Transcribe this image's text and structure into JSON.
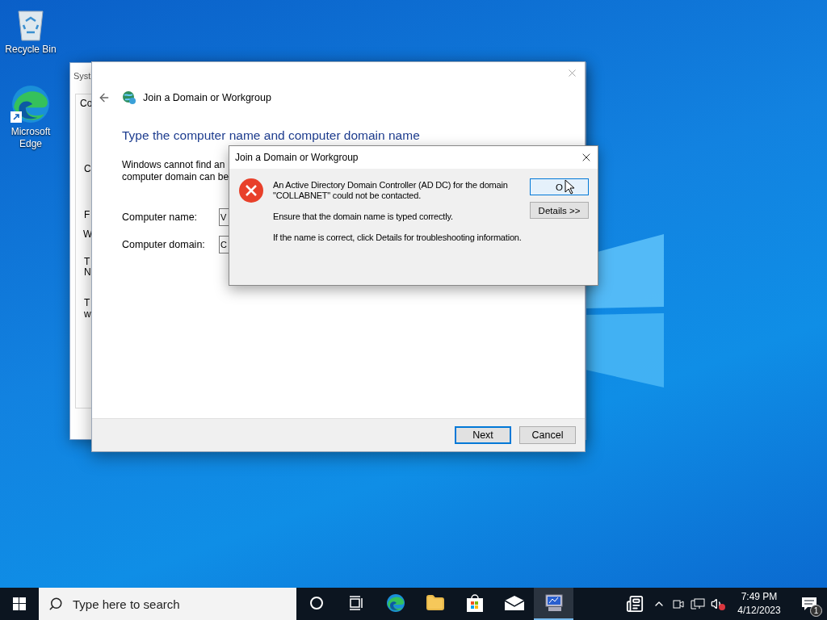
{
  "desktop_icons": [
    {
      "kind": "recycle",
      "label": "Recycle Bin"
    },
    {
      "kind": "edge",
      "label": "Microsoft Edge"
    }
  ],
  "back_window": {
    "title": "Syst",
    "tab": "Co",
    "fragments": [
      "C",
      "F",
      "W",
      "T",
      "N",
      "T",
      "w"
    ]
  },
  "wizard": {
    "title": "Join a Domain or Workgroup",
    "heading": "Type the computer name and computer domain name",
    "description_lines": [
      "Windows cannot find an",
      "computer domain can be"
    ],
    "fields": [
      {
        "label": "Computer name:",
        "value": "V"
      },
      {
        "label": "Computer domain:",
        "value": "C"
      }
    ],
    "buttons": [
      {
        "label": "Next",
        "default": true
      },
      {
        "label": "Cancel",
        "default": false
      }
    ]
  },
  "dialog": {
    "title": "Join a Domain or Workgroup",
    "message": "An Active Directory Domain Controller (AD DC) for the domain\n\"COLLABNET\" could not be contacted.",
    "paragraphs": [
      "Ensure that the domain name is typed correctly.",
      "If the name is correct, click Details for troubleshooting information."
    ],
    "buttons": [
      {
        "label": "O",
        "focused": true
      },
      {
        "label": "Details >>",
        "focused": false
      }
    ]
  },
  "taskbar": {
    "search_placeholder": "Type here to search",
    "apps": [
      {
        "kind": "cortana",
        "active": false
      },
      {
        "kind": "taskview",
        "active": false
      },
      {
        "kind": "edge",
        "active": false
      },
      {
        "kind": "explorer",
        "active": false
      },
      {
        "kind": "store",
        "active": false
      },
      {
        "kind": "mail",
        "active": false
      },
      {
        "kind": "system",
        "active": true
      }
    ],
    "time": "7:49 PM",
    "date": "4/12/2023",
    "notification_count": "1"
  }
}
